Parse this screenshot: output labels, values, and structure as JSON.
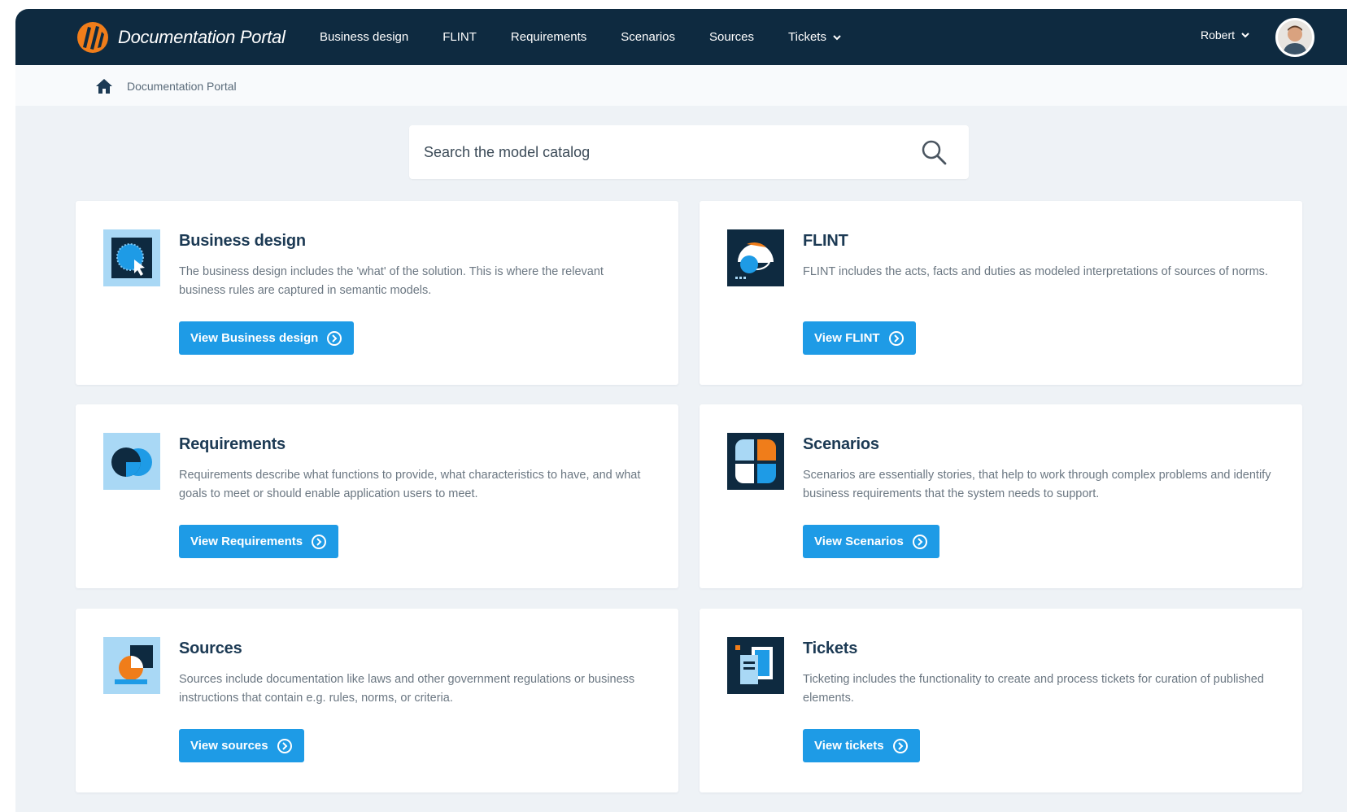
{
  "header": {
    "title": "Documentation Portal",
    "nav": [
      {
        "label": "Business design"
      },
      {
        "label": "FLINT"
      },
      {
        "label": "Requirements"
      },
      {
        "label": "Scenarios"
      },
      {
        "label": "Sources"
      },
      {
        "label": "Tickets"
      }
    ],
    "user_name": "Robert"
  },
  "breadcrumb": {
    "label": "Documentation Portal"
  },
  "search": {
    "placeholder": "Search the model catalog"
  },
  "cards": [
    {
      "title": "Business design",
      "description": "The business design includes the 'what' of the solution. This is where the relevant business rules are captured in semantic models.",
      "button": "View Business design"
    },
    {
      "title": "FLINT",
      "description": "FLINT includes the acts, facts and duties as modeled interpretations of sources of norms.",
      "button": "View FLINT"
    },
    {
      "title": "Requirements",
      "description": " Requirements describe what functions to provide, what characteristics to have, and what goals to meet or should enable application users to meet.",
      "button": "View Requirements"
    },
    {
      "title": "Scenarios",
      "description": "Scenarios are essentially stories, that help to work through complex problems and identify business requirements that the system needs to support.",
      "button": "View Scenarios"
    },
    {
      "title": "Sources",
      "description": "Sources include documentation like laws and other government regulations or business instructions that contain e.g. rules, norms, or criteria.",
      "button": "View sources"
    },
    {
      "title": "Tickets",
      "description": "Ticketing includes the functionality to create and process tickets for curation of published elements.",
      "button": "View tickets"
    }
  ],
  "colors": {
    "header_bg": "#0e2a40",
    "page_bg": "#eef2f6",
    "accent": "#1e9be6",
    "orange": "#f07d1a"
  },
  "icons": {
    "brand": "portal-logo-icon",
    "home": "home-icon",
    "search": "search-icon",
    "chevron": "chevron-down-icon",
    "button": "arrow-circle-right-icon"
  }
}
